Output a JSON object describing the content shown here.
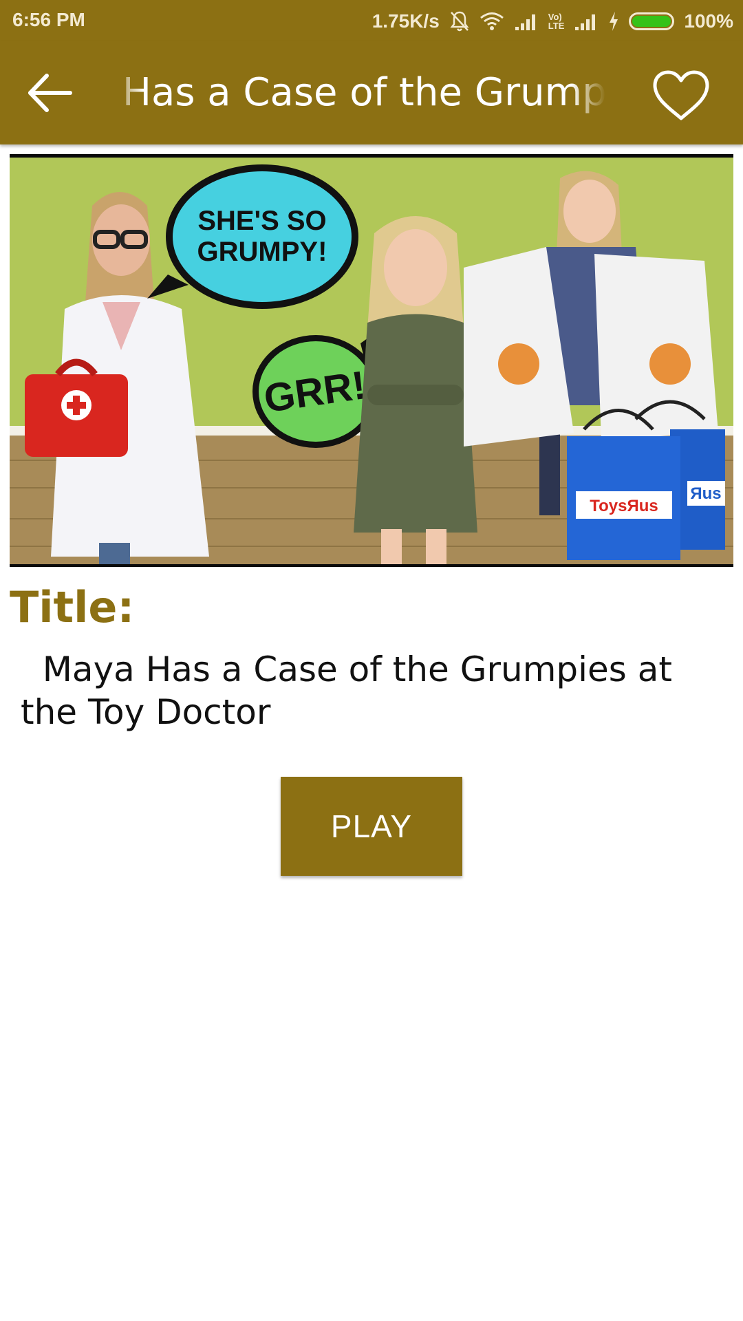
{
  "status_bar": {
    "time": "6:56 PM",
    "network_speed": "1.75K/s",
    "battery_percent": "100%",
    "battery_level": 1.0,
    "lte_label": "LTE",
    "volte_label": "Vo)",
    "icons": [
      "mute-bell-icon",
      "wifi-icon",
      "signal-icon",
      "volte-icon",
      "signal-icon",
      "charging-icon",
      "battery-icon"
    ]
  },
  "toolbar": {
    "title": "Maya Has a Case of the Grumpies at the Toy Doctor",
    "back_icon": "arrow-left-icon",
    "favorite_icon": "heart-outline-icon"
  },
  "thumbnail": {
    "bubble_1": "SHE'S SO GRUMPY!",
    "bubble_1_line1": "SHE'S SO",
    "bubble_1_line2": "GRUMPY!",
    "bubble_2": "GRR!",
    "bag_logo": "ToysЯus",
    "bag_logo_2": "Яus"
  },
  "content": {
    "title_label": "Title:",
    "video_title": "  Maya Has a Case of the Grumpies at the Toy Doctor",
    "play_label": "PLAY"
  },
  "colors": {
    "brand": "#8c7013",
    "battery_green": "#35c218",
    "text": "#111111"
  }
}
